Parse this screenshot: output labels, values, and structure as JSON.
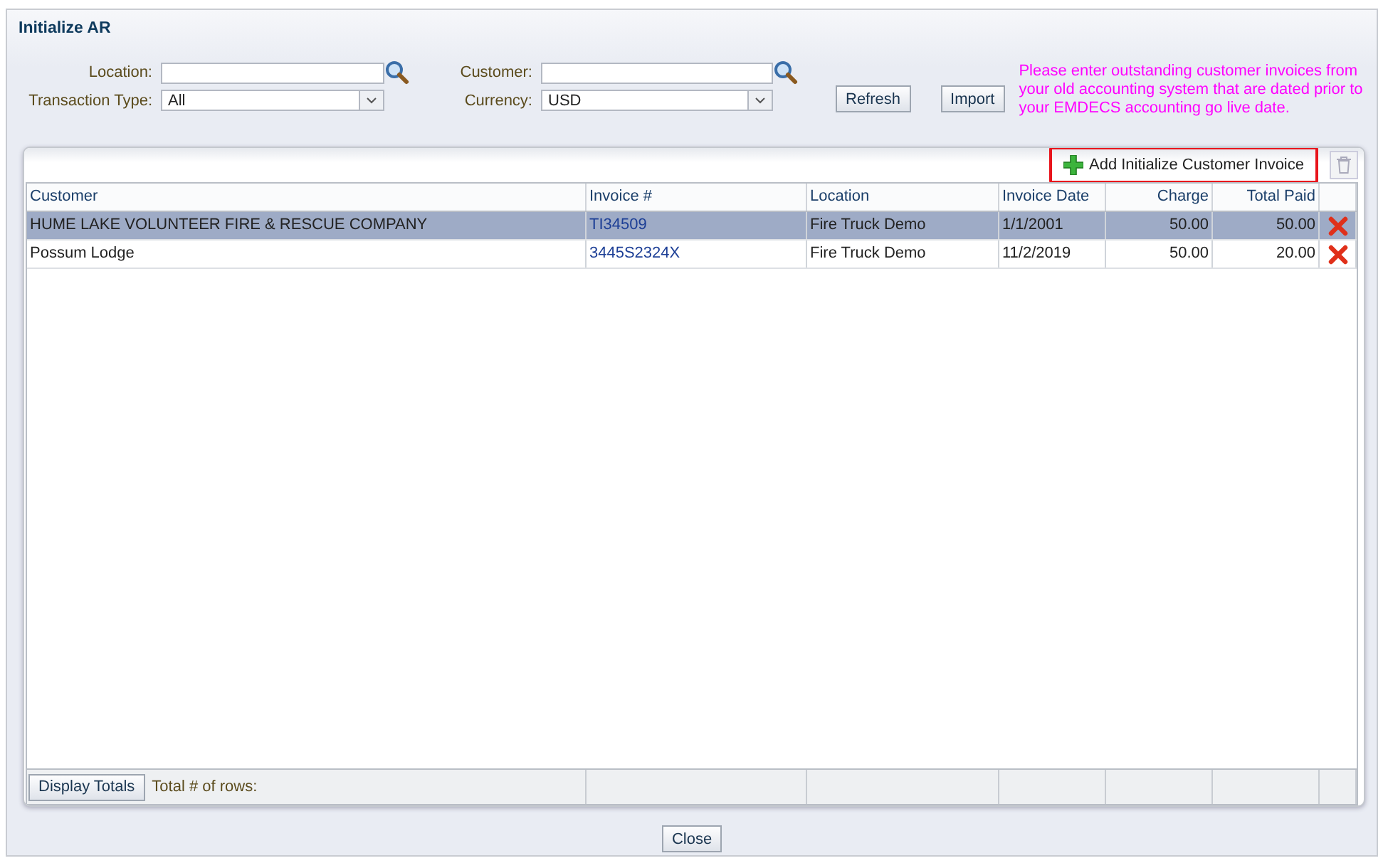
{
  "window": {
    "title": "Initialize AR"
  },
  "filters": {
    "location": {
      "label": "Location:"
    },
    "customer": {
      "label": "Customer:"
    },
    "transaction_type": {
      "label": "Transaction Type:",
      "value": "All"
    },
    "currency": {
      "label": "Currency:",
      "value": "USD"
    }
  },
  "buttons": {
    "refresh": "Refresh",
    "import": "Import"
  },
  "notice": "Please enter outstanding customer invoices from your old accounting system that are dated prior to your EMDECS accounting go live date.",
  "toolbar": {
    "add_button": "Add Initialize Customer Invoice",
    "highlighted": true
  },
  "table": {
    "columns": [
      "Customer",
      "Invoice #",
      "Location",
      "Invoice Date",
      "Charge",
      "Total Paid"
    ],
    "rows": [
      {
        "customer": "HUME LAKE VOLUNTEER FIRE & RESCUE COMPANY",
        "invoice": "TI34509",
        "location": "Fire Truck Demo",
        "invoice_date": "1/1/2001",
        "charge": "50.00",
        "total_paid": "50.00",
        "selected": true
      },
      {
        "customer": "Possum Lodge",
        "invoice": "3445S2324X",
        "location": "Fire Truck Demo",
        "invoice_date": "11/2/2019",
        "charge": "50.00",
        "total_paid": "20.00",
        "selected": false
      }
    ],
    "footer": {
      "display_totals": "Display Totals",
      "rows_label": "Total # of rows:"
    }
  },
  "close_button": "Close"
}
